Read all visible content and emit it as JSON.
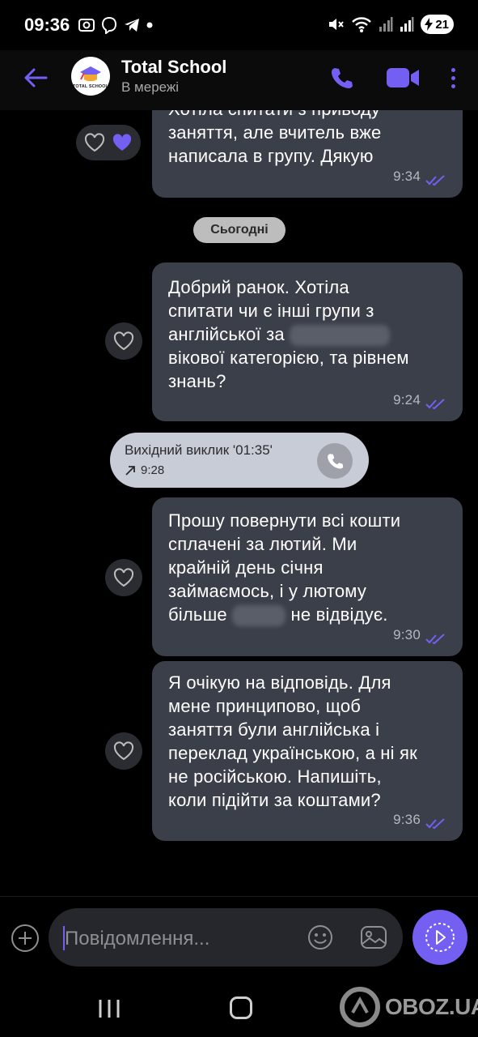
{
  "status_bar": {
    "time": "09:36",
    "battery": "21"
  },
  "header": {
    "contact_name": "Total School",
    "contact_status": "В мережі",
    "avatar_text": "TOTAL SCHOOL"
  },
  "messages": [
    {
      "text": "Хотіла спитати з приводу\nзаняття, але вчитель вже\nнаписала в групу. Дякую",
      "time": "9:34"
    },
    {
      "text_a": "Добрий ранок. Хотіла\nспитати чи є інші групи з\nанглійської за ",
      "text_b": "\nвікової категорією, та рівнем\nзнань?",
      "time": "9:24"
    },
    {
      "text_a": "Прошу повернути всі кошти\nсплачені за лютий. Ми\nкрайній день січня\nзаймаємось, і у лютому\nбільше ",
      "text_b": " не відвідує.",
      "time": "9:30"
    },
    {
      "text": "Я очікую на відповідь. Для\nмене принципово, щоб\nзаняття були англійська і\nпереклад українською, а ні як\nне російською. Напишіть,\nколи підійти за коштами?",
      "time": "9:36"
    }
  ],
  "date_separator": "Сьогодні",
  "call": {
    "title": "Вихідний виклик '01:35'",
    "time": "9:28"
  },
  "input": {
    "placeholder": "Повідомлення..."
  },
  "watermark": "OBOZ.UA",
  "colors": {
    "accent": "#7360f2",
    "bubble": "#3b3f4a",
    "background": "#000000"
  }
}
